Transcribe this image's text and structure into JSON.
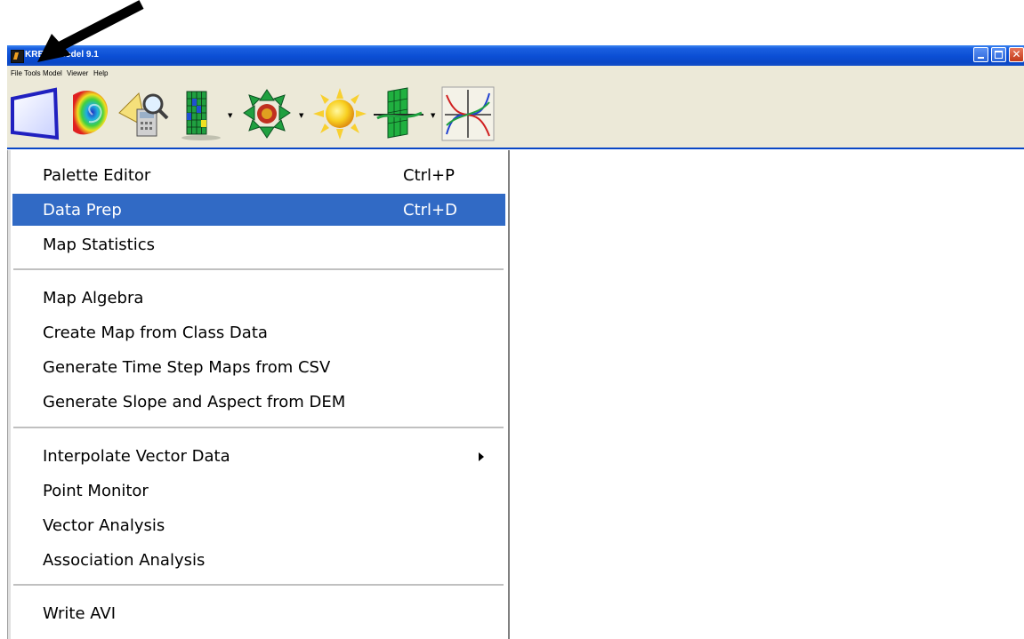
{
  "window": {
    "title": "KRESS Model 9.1",
    "controls": [
      "minimize-icon",
      "maximize-icon",
      "close-icon"
    ]
  },
  "menubar": {
    "items": [
      "File",
      "Tools",
      "Model",
      "Viewer",
      "Help"
    ]
  },
  "toolbar": {
    "buttons": [
      "blank-map-icon",
      "spiral-map-icon",
      "query-tools-icon",
      "grid-view-icon",
      "spatial-model-icon",
      "sun-icon",
      "grid-profile-icon",
      "curve-plot-icon"
    ]
  },
  "tools_menu": {
    "items": [
      {
        "label": "Palette Editor",
        "shortcut": "Ctrl+P"
      },
      {
        "label": "Data Prep",
        "shortcut": "Ctrl+D",
        "highlighted": true
      },
      {
        "label": "Map Statistics"
      },
      {
        "label": "Map Algebra"
      },
      {
        "label": "Create Map from Class Data"
      },
      {
        "label": "Generate Time Step Maps from CSV"
      },
      {
        "label": "Generate Slope and Aspect from DEM"
      },
      {
        "label": "Interpolate Vector Data",
        "submenu": true
      },
      {
        "label": "Point Monitor"
      },
      {
        "label": "Vector Analysis"
      },
      {
        "label": "Association Analysis"
      },
      {
        "label": "Write AVI"
      }
    ]
  },
  "colors": {
    "titlebar": "#0b4ed4",
    "highlight": "#316ac5",
    "menubar": "#ece9d8"
  }
}
